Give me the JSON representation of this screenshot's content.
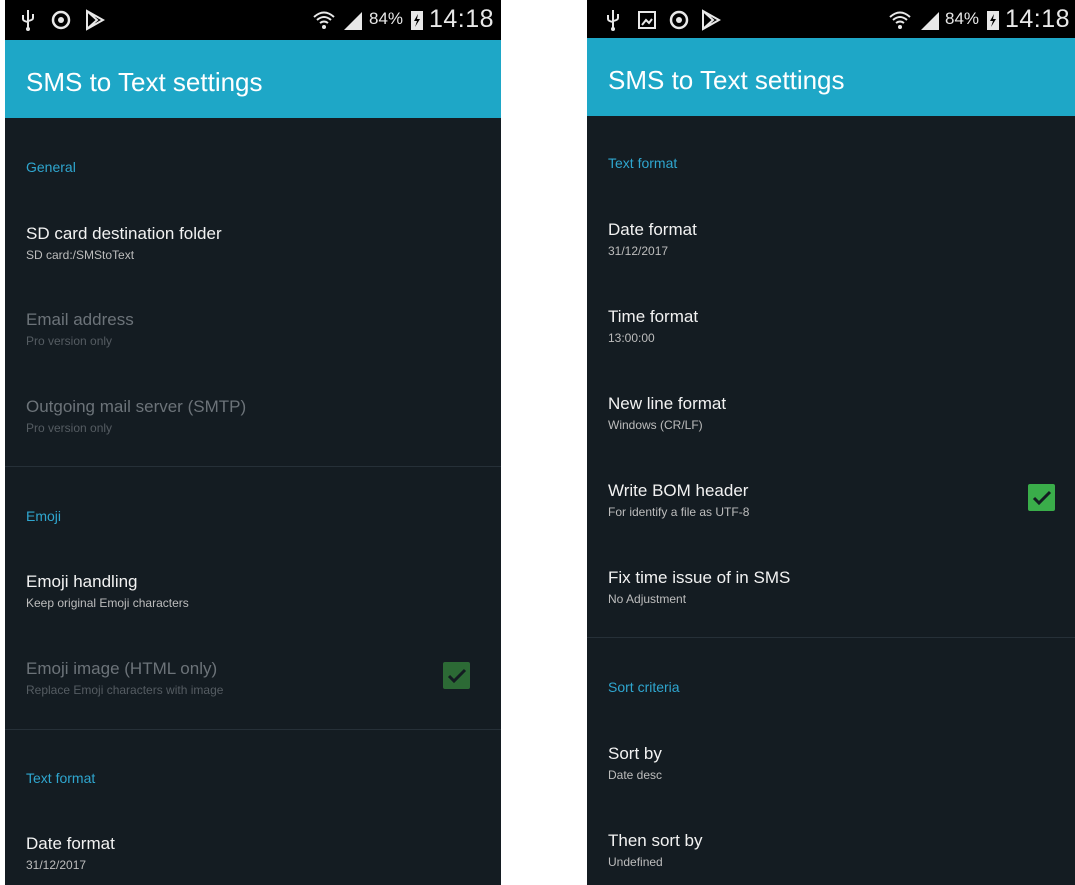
{
  "status_bar": {
    "battery_percent": "84%",
    "time": "14:18",
    "icons_left": [
      "usb-icon",
      "sync-icon",
      "play-store-icon"
    ],
    "icons_right": [
      "wifi-icon",
      "signal-icon",
      "battery-charging-icon"
    ]
  },
  "left_screen": {
    "title": "SMS to Text settings",
    "sections": [
      {
        "header": "General",
        "items": [
          {
            "title": "SD card destination folder",
            "summary": "SD card:/SMStoText",
            "enabled": true
          },
          {
            "title": "Email address",
            "summary": "Pro version only",
            "enabled": false
          },
          {
            "title": "Outgoing mail server (SMTP)",
            "summary": "Pro version only",
            "enabled": false
          }
        ]
      },
      {
        "header": "Emoji",
        "items": [
          {
            "title": "Emoji handling",
            "summary": "Keep original Emoji characters",
            "enabled": true
          },
          {
            "title": "Emoji image (HTML only)",
            "summary": "Replace Emoji characters with image",
            "enabled": false,
            "checked": true
          }
        ]
      },
      {
        "header": "Text format",
        "items": [
          {
            "title": "Date format",
            "summary": "31/12/2017",
            "enabled": true
          }
        ]
      }
    ]
  },
  "right_screen": {
    "title": "SMS to Text settings",
    "status_extra_icon": "image-icon",
    "sections": [
      {
        "header": "Text format",
        "items": [
          {
            "title": "Date format",
            "summary": "31/12/2017",
            "enabled": true
          },
          {
            "title": "Time format",
            "summary": "13:00:00",
            "enabled": true
          },
          {
            "title": "New line format",
            "summary": "Windows (CR/LF)",
            "enabled": true
          },
          {
            "title": "Write BOM header",
            "summary": "For identify a file as UTF-8",
            "enabled": true,
            "checked": true
          },
          {
            "title": "Fix time issue of in SMS",
            "summary": "No Adjustment",
            "enabled": true
          }
        ]
      },
      {
        "header": "Sort criteria",
        "items": [
          {
            "title": "Sort by",
            "summary": "Date desc",
            "enabled": true
          },
          {
            "title": "Then sort by",
            "summary": "Undefined",
            "enabled": true
          }
        ]
      }
    ]
  },
  "colors": {
    "app_bar": "#1ea7c7",
    "background": "#141c22",
    "section_header": "#2fa6cf",
    "checkbox": "#3aad4a"
  }
}
